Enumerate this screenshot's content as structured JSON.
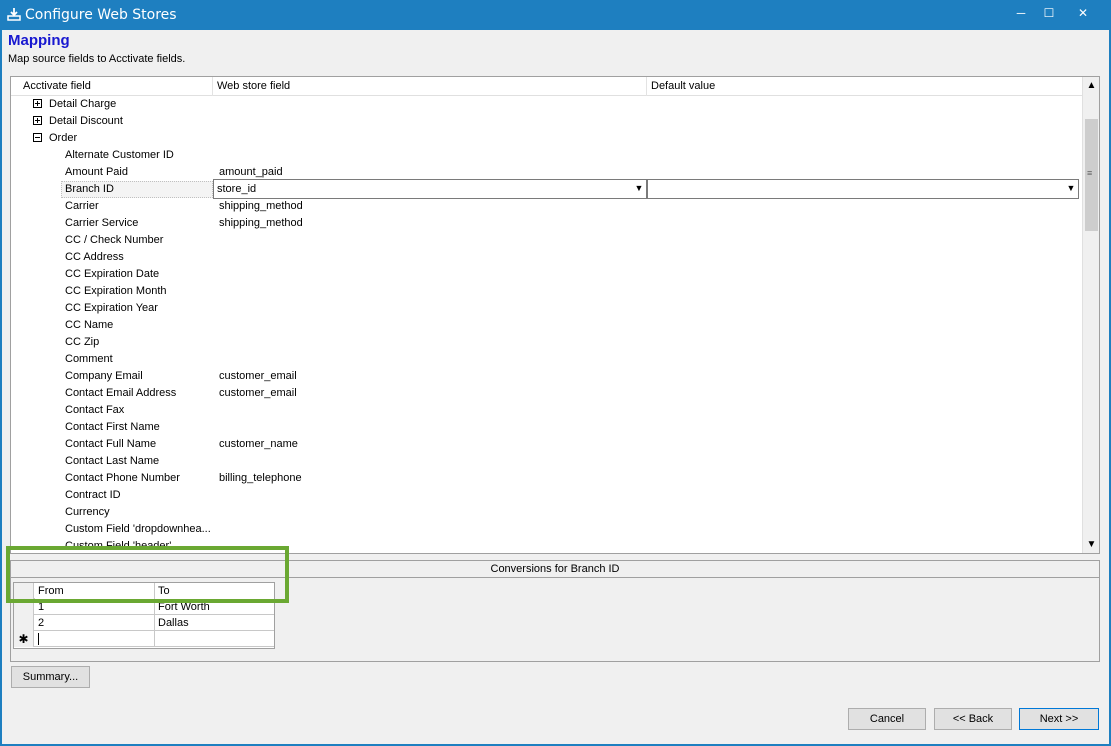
{
  "window": {
    "title": "Configure Web Stores",
    "minimize": "─",
    "maximize": "☐",
    "close": "✕"
  },
  "page": {
    "title": "Mapping",
    "subtitle": "Map source fields to Acctivate fields."
  },
  "grid": {
    "columns": [
      "Acctivate field",
      "Web store field",
      "Default value"
    ],
    "rows": [
      {
        "label": "Detail Charge",
        "value": "",
        "level": 1,
        "expander": "plus"
      },
      {
        "label": "Detail Discount",
        "value": "",
        "level": 1,
        "expander": "plus"
      },
      {
        "label": "Order",
        "value": "",
        "level": 1,
        "expander": "minus"
      },
      {
        "label": "Alternate Customer ID",
        "value": "",
        "level": 2
      },
      {
        "label": "Amount Paid",
        "value": "amount_paid",
        "level": 2
      },
      {
        "label": "Branch ID",
        "value": "store_id",
        "level": 2,
        "selected": true,
        "default": ""
      },
      {
        "label": "Carrier",
        "value": "shipping_method",
        "level": 2
      },
      {
        "label": "Carrier Service",
        "value": "shipping_method",
        "level": 2
      },
      {
        "label": "CC / Check Number",
        "value": "",
        "level": 2
      },
      {
        "label": "CC Address",
        "value": "",
        "level": 2
      },
      {
        "label": "CC Expiration Date",
        "value": "",
        "level": 2
      },
      {
        "label": "CC Expiration Month",
        "value": "",
        "level": 2
      },
      {
        "label": "CC Expiration Year",
        "value": "",
        "level": 2
      },
      {
        "label": "CC Name",
        "value": "",
        "level": 2
      },
      {
        "label": "CC Zip",
        "value": "",
        "level": 2
      },
      {
        "label": "Comment",
        "value": "",
        "level": 2
      },
      {
        "label": "Company Email",
        "value": "customer_email",
        "level": 2
      },
      {
        "label": "Contact Email Address",
        "value": "customer_email",
        "level": 2
      },
      {
        "label": "Contact Fax",
        "value": "",
        "level": 2
      },
      {
        "label": "Contact First Name",
        "value": "",
        "level": 2
      },
      {
        "label": "Contact Full Name",
        "value": "customer_name",
        "level": 2
      },
      {
        "label": "Contact Last Name",
        "value": "",
        "level": 2
      },
      {
        "label": "Contact Phone Number",
        "value": "billing_telephone",
        "level": 2
      },
      {
        "label": "Contract ID",
        "value": "",
        "level": 2
      },
      {
        "label": "Currency",
        "value": "",
        "level": 2
      },
      {
        "label": "Custom Field 'dropdownhea...",
        "value": "",
        "level": 2
      },
      {
        "label": "Custom Field 'header'",
        "value": "",
        "level": 2
      }
    ]
  },
  "conversions": {
    "title": "Conversions for Branch ID",
    "columns": [
      "From",
      "To"
    ],
    "rows": [
      {
        "from": "1",
        "to": "Fort Worth"
      },
      {
        "from": "2",
        "to": "Dallas"
      }
    ],
    "new_row_marker": "✱"
  },
  "buttons": {
    "summary": "Summary...",
    "cancel": "Cancel",
    "back": "<< Back",
    "next": "Next >>"
  },
  "colors": {
    "titlebar": "#1e7fc0",
    "page_title": "#1818d0",
    "highlight": "#6aa832"
  }
}
